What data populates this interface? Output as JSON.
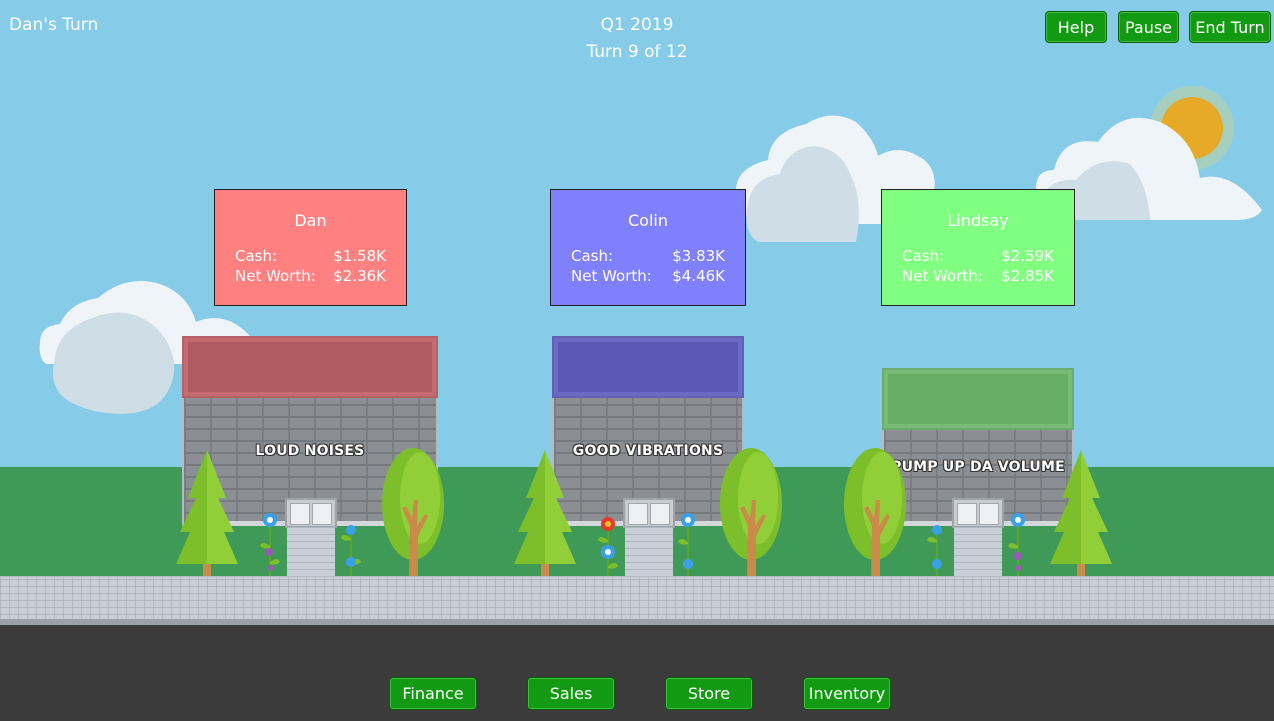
{
  "hud": {
    "current_turn_player": "Dan's Turn",
    "quarter": "Q1 2019",
    "turn": "Turn 9 of 12"
  },
  "top_buttons": {
    "help": "Help",
    "pause": "Pause",
    "end_turn": "End Turn"
  },
  "players": [
    {
      "name": "Dan",
      "cash_label": "Cash:",
      "cash": "$1.58K",
      "net_worth_label": "Net Worth:",
      "net_worth": "$2.36K",
      "color": "#ff8080",
      "store_name": "LOUD NOISES",
      "awning_color": "#b05a62"
    },
    {
      "name": "Colin",
      "cash_label": "Cash:",
      "cash": "$3.83K",
      "net_worth_label": "Net Worth:",
      "net_worth": "$4.46K",
      "color": "#8080ff",
      "store_name": "GOOD VIBRATIONS",
      "awning_color": "#5a58b2"
    },
    {
      "name": "Lindsay",
      "cash_label": "Cash:",
      "cash": "$2.59K",
      "net_worth_label": "Net Worth:",
      "net_worth": "$2.85K",
      "color": "#80ff80",
      "store_name": "PUMP UP DA VOLUME",
      "awning_color": "#66ad66"
    }
  ],
  "bottom_buttons": {
    "finance": "Finance",
    "sales": "Sales",
    "store": "Store",
    "inventory": "Inventory"
  },
  "colors": {
    "sky": "#86cce8",
    "grass": "#3f9957",
    "road": "#3b3b3b",
    "button_green": "#129a12",
    "sun": "#e6aa28"
  },
  "icons": [
    "sun-icon",
    "cloud-icon",
    "pine-tree-icon",
    "leafy-tree-icon",
    "flower-icon",
    "door-icon"
  ]
}
